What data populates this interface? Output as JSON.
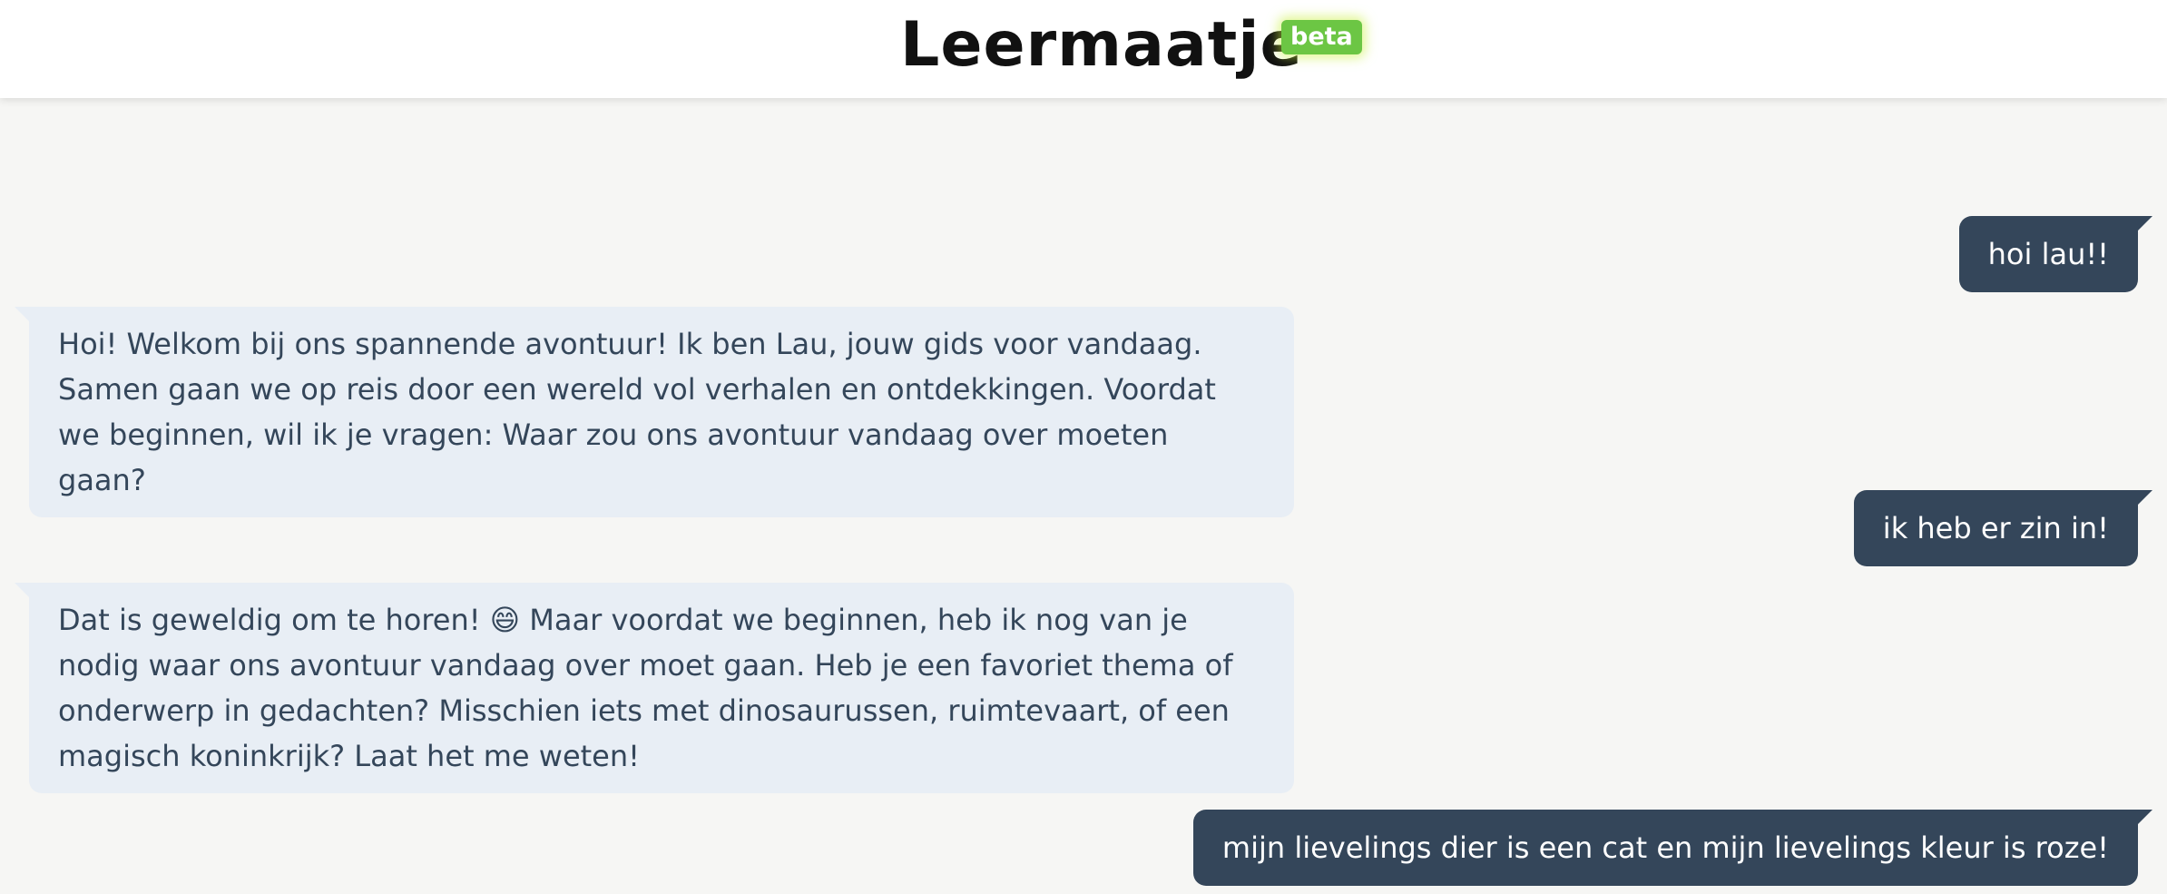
{
  "header": {
    "title": "Leermaatje",
    "badge": "beta"
  },
  "messages": [
    {
      "role": "user",
      "text": "hoi lau!!"
    },
    {
      "role": "assistant",
      "text": "Hoi! Welkom bij ons spannende avontuur! Ik ben Lau, jouw gids voor vandaag. Samen gaan we op reis door een wereld vol verhalen en ontdekkingen. Voordat we beginnen, wil ik je vragen: Waar zou ons avontuur vandaag over moeten gaan?"
    },
    {
      "role": "user",
      "text": "ik heb er zin in!"
    },
    {
      "role": "assistant",
      "text": "Dat is geweldig om te horen! 😄 Maar voordat we beginnen, heb ik nog van je nodig waar ons avontuur vandaag over moet gaan. Heb je een favoriet thema of onderwerp in gedachten? Misschien iets met dinosaurussen, ruimtevaart, of een magisch koninkrijk? Laat het me weten!"
    },
    {
      "role": "user",
      "text": "mijn lievelings dier is een cat en mijn lievelings kleur is roze!"
    }
  ],
  "colors": {
    "background": "#f6f6f4",
    "header_background": "#ffffff",
    "user_bubble": "#34465a",
    "assistant_bubble": "#e8eef5",
    "assistant_text": "#34465a",
    "badge": "#6cc644"
  }
}
